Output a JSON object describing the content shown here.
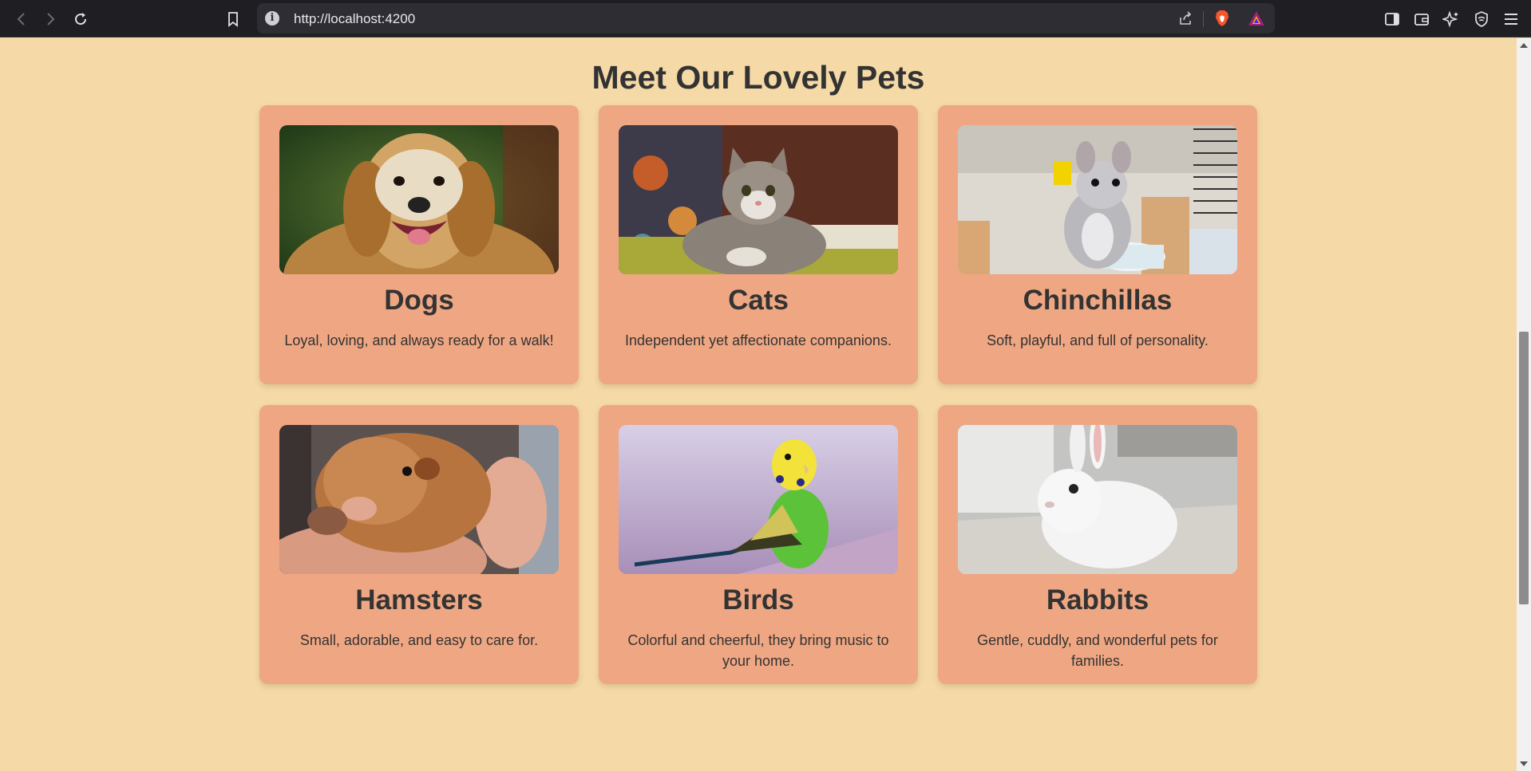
{
  "browser": {
    "url": "http://localhost:4200",
    "icons": [
      "back-icon",
      "forward-icon",
      "reload-icon",
      "bookmark-icon",
      "site-info-icon",
      "share-icon",
      "brave-shields-icon",
      "brave-rewards-icon",
      "sidebar-icon",
      "wallet-icon",
      "leo-ai-icon",
      "vpn-icon",
      "menu-icon"
    ]
  },
  "page": {
    "title": "Meet Our Lovely Pets"
  },
  "pets": [
    {
      "name": "Dogs",
      "description": "Loyal, loving, and always ready for a walk!"
    },
    {
      "name": "Cats",
      "description": "Independent yet affectionate companions."
    },
    {
      "name": "Chinchillas",
      "description": "Soft, playful, and full of personality."
    },
    {
      "name": "Hamsters",
      "description": "Small, adorable, and easy to care for."
    },
    {
      "name": "Birds",
      "description": "Colorful and cheerful, they bring music to your home."
    },
    {
      "name": "Rabbits",
      "description": "Gentle, cuddly, and wonderful pets for families."
    }
  ],
  "colors": {
    "page_background": "#f5d9a6",
    "card_background": "#efa783",
    "text": "#333333",
    "browser_chrome": "#1f1f23"
  }
}
